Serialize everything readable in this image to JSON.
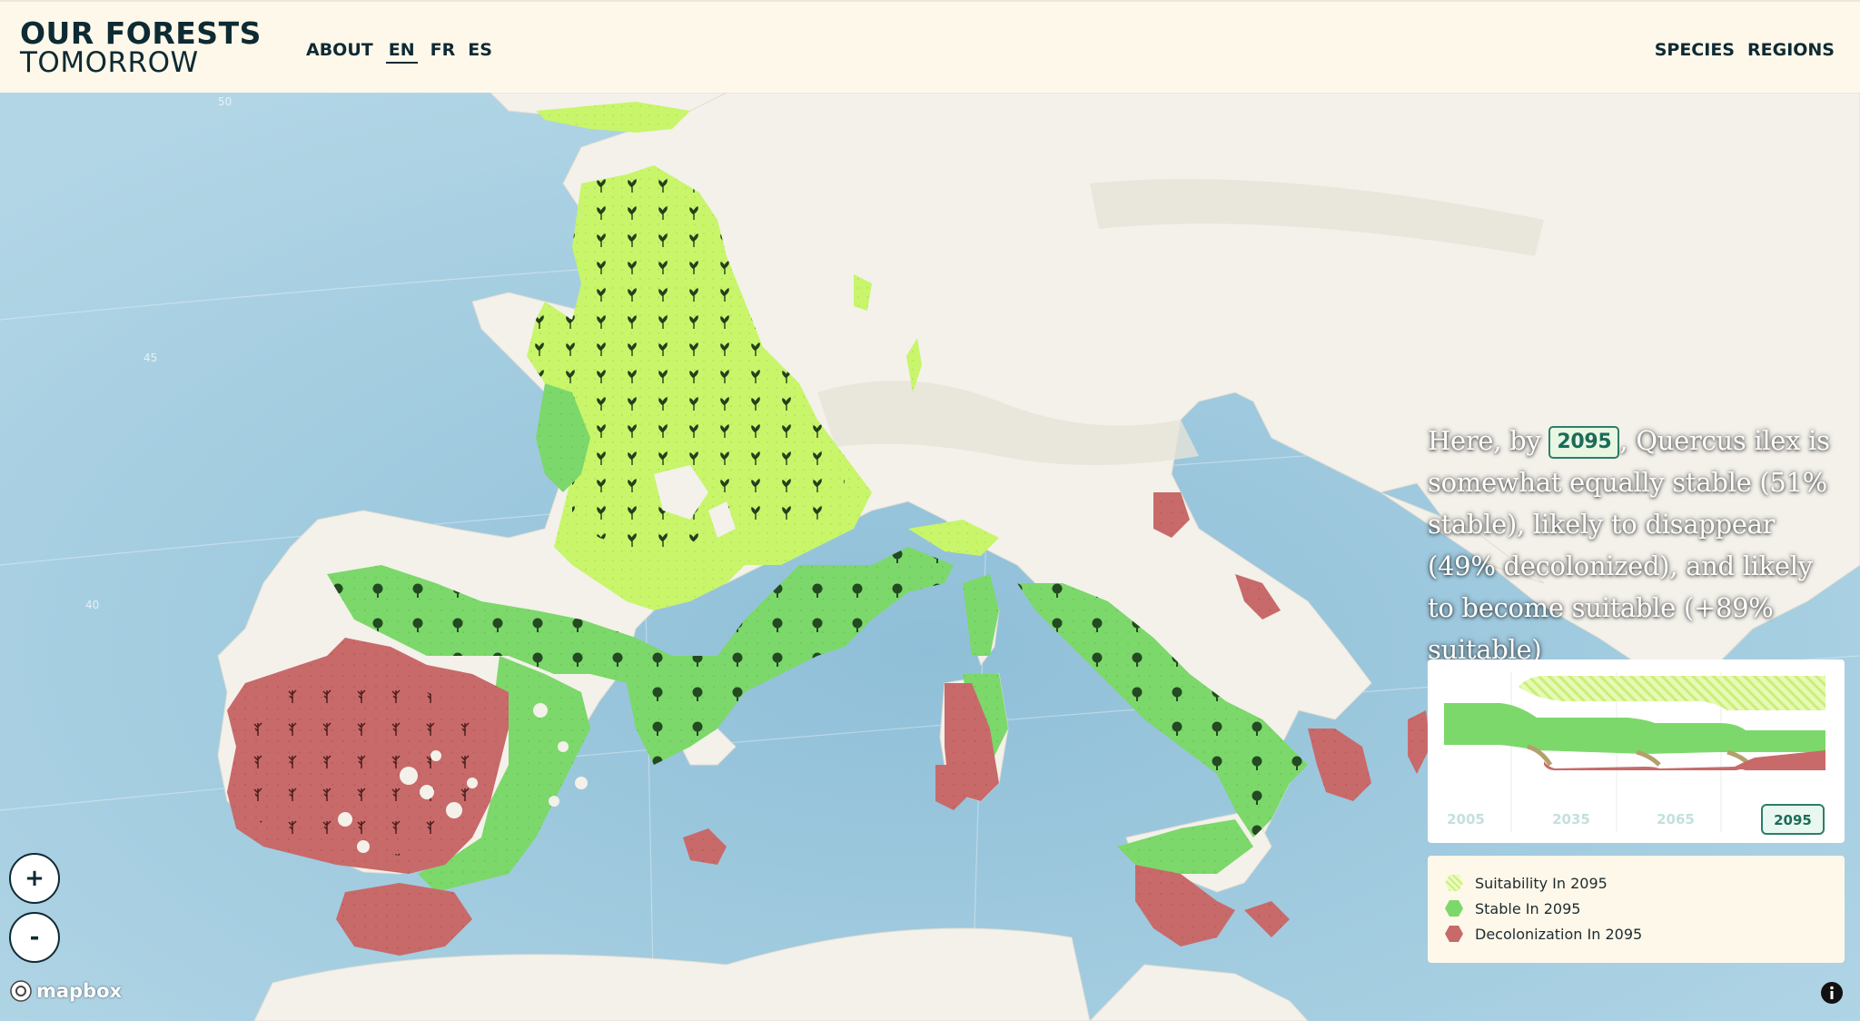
{
  "header": {
    "logo_line1": "OUR FORESTS",
    "logo_line2": "TOMORROW",
    "nav_left": [
      "ABOUT",
      "EN",
      "FR",
      "ES"
    ],
    "nav_right": [
      "SPECIES",
      "REGIONS"
    ]
  },
  "narrative": {
    "prefix": "Here, by",
    "year": "2095",
    "text": ", Quercus ilex is somewhat equally stable (51% stable), likely to disappear (49% decolonized), and likely to become suitable (+89% suitable)"
  },
  "timeline": {
    "years": [
      "2005",
      "2035",
      "2065",
      "2095"
    ],
    "selected": "2095"
  },
  "legend": [
    {
      "label": "Suitability In 2095",
      "icon": "suitability-hatch-icon"
    },
    {
      "label": "Stable In 2095",
      "icon": "stable-hexagon-icon"
    },
    {
      "label": "Decolonization In 2095",
      "icon": "decolonization-hexagon-icon"
    }
  ],
  "map_labels": {
    "lat_50": "50",
    "lat_45": "45",
    "lat_40": "40",
    "lat_45_east": "45"
  },
  "controls": {
    "zoom_in": "+",
    "zoom_out": "-",
    "attribution": "mapbox"
  },
  "colors": {
    "suitability": "#c8f56a",
    "stable": "#7cd86a",
    "decolonization": "#c86a6a",
    "sea": "#a9cfe2",
    "land": "#f3f1ea",
    "accent": "#2e7d6a"
  }
}
